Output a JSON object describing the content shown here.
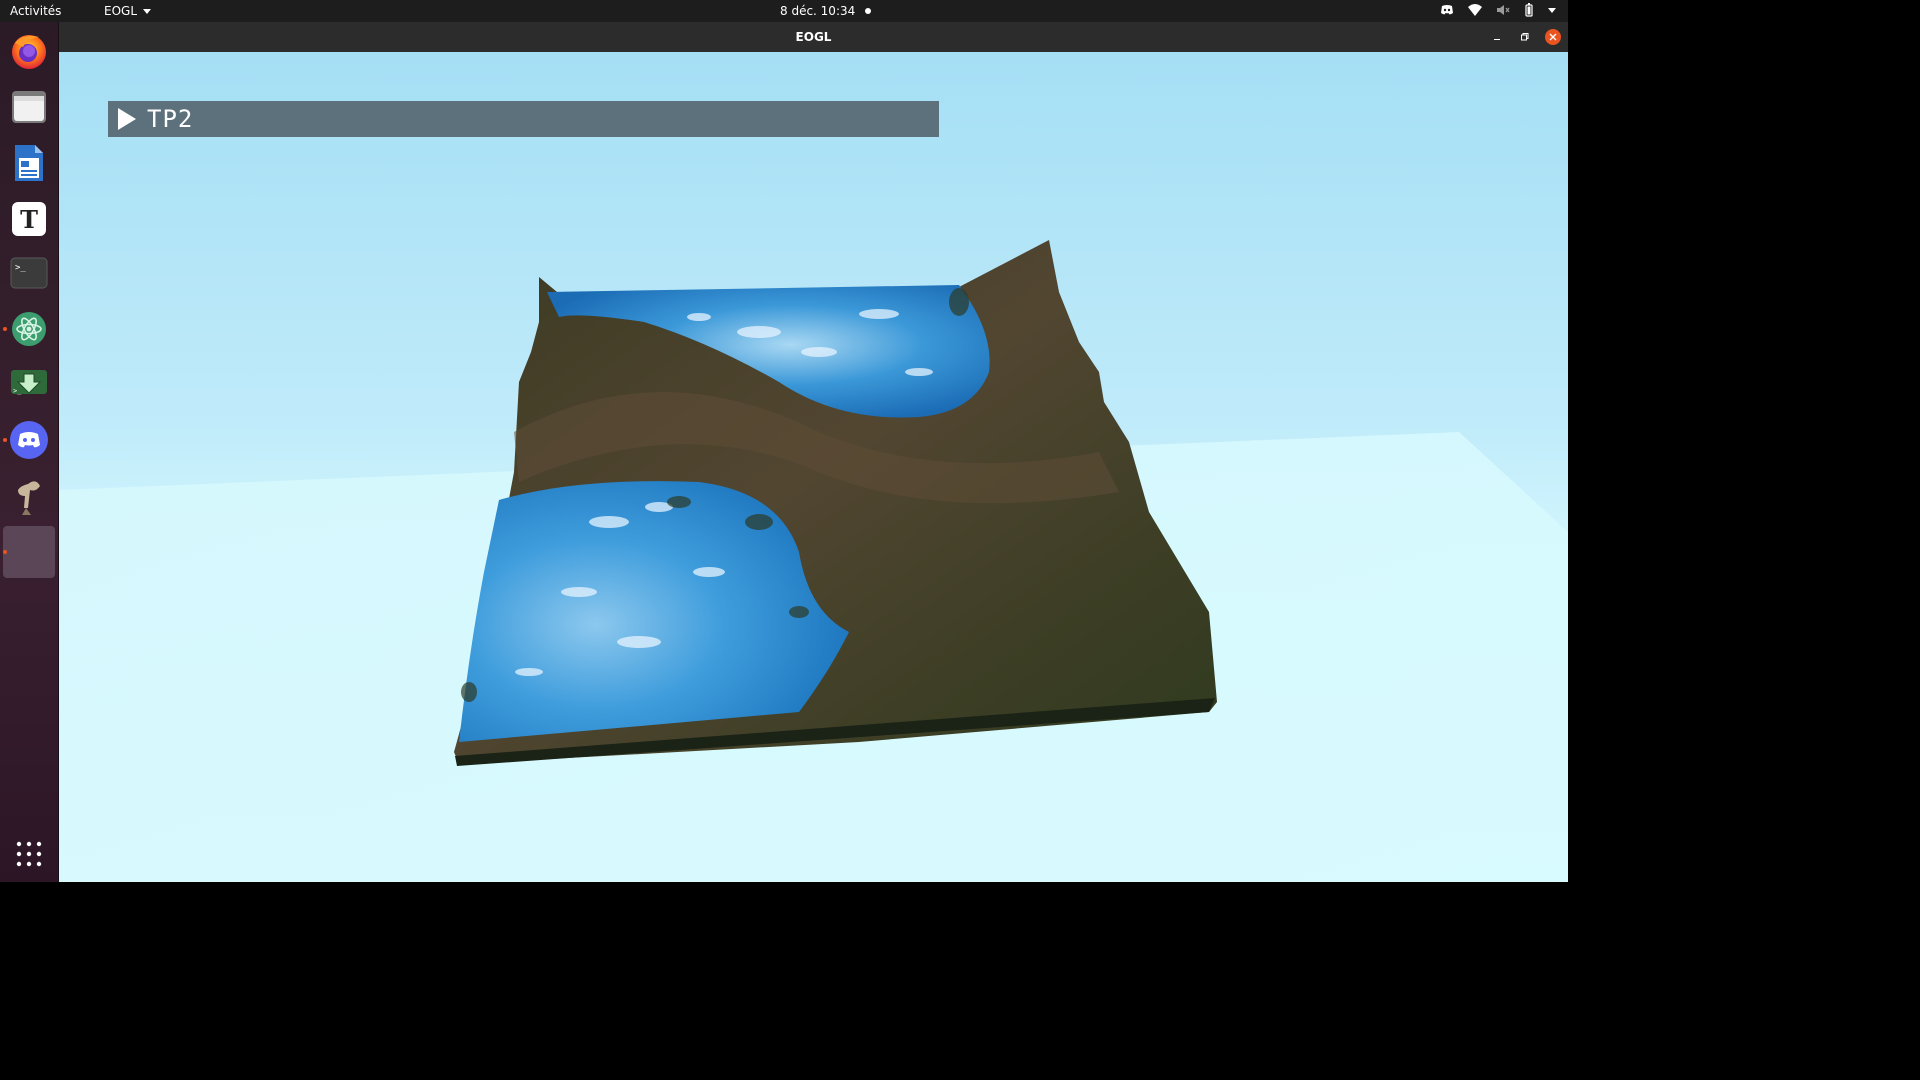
{
  "topbar": {
    "activities": "Activités",
    "app_menu": "EOGL",
    "clock": "8 déc.  10:34",
    "tray_icons": [
      "discord-tray-icon",
      "wifi-icon",
      "volume-muted-icon",
      "battery-icon",
      "system-menu-caret-icon"
    ]
  },
  "dock": {
    "items": [
      {
        "name": "firefox",
        "running": false
      },
      {
        "name": "files",
        "running": false
      },
      {
        "name": "libreoffice-writer",
        "running": false
      },
      {
        "name": "text-editor",
        "running": false
      },
      {
        "name": "terminal",
        "running": false
      },
      {
        "name": "atom",
        "running": true
      },
      {
        "name": "install-manager",
        "running": false
      },
      {
        "name": "discord",
        "running": true
      },
      {
        "name": "gimp",
        "running": false
      },
      {
        "name": "eogl",
        "running": true,
        "active": true
      }
    ],
    "show_apps": "show-applications-icon"
  },
  "window": {
    "title": "EOGL",
    "controls": [
      "minimize",
      "maximize",
      "close"
    ]
  },
  "app": {
    "menu_label": "TP2",
    "colors": {
      "sky_top": "#a5dff5",
      "sky_bottom": "#dcf9fe",
      "menu_bar": "#5c717c",
      "water": "#3a9ad6",
      "terrain": "#4a4530",
      "close_button": "#e95420"
    }
  }
}
